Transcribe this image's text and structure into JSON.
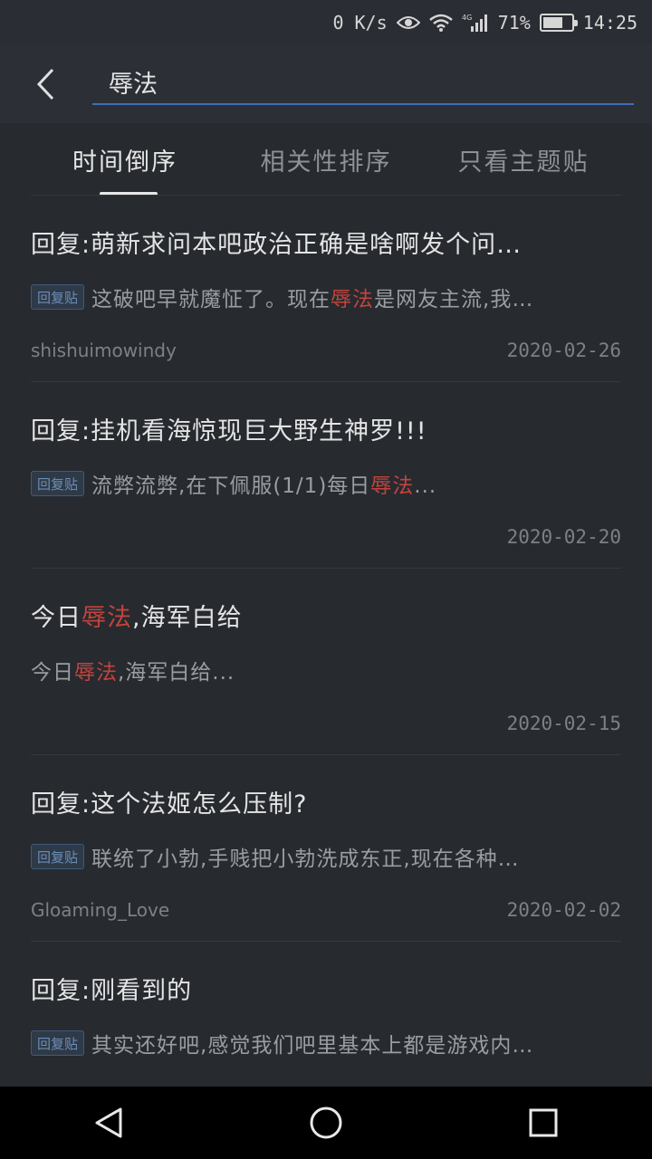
{
  "status_bar": {
    "net_speed": "0 K/s",
    "network": "4G",
    "battery": "71%",
    "battery_level": 0.71,
    "time": "14:25"
  },
  "search": {
    "query": "辱法"
  },
  "tabs": [
    {
      "label": "时间倒序",
      "active": true
    },
    {
      "label": "相关性排序",
      "active": false
    },
    {
      "label": "只看主题贴",
      "active": false
    }
  ],
  "results": [
    {
      "title": "回复:萌新求问本吧政治正确是啥啊发个问…",
      "badge": "回复贴",
      "snippet_before": "这破吧早就魔怔了。现在",
      "snippet_hl": "辱法",
      "snippet_after": "是网友主流,我…",
      "author": "shishuimowindy",
      "date": "2020-02-26"
    },
    {
      "title": "回复:挂机看海惊现巨大野生神罗!!!",
      "badge": "回复贴",
      "snippet_before": "流弊流弊,在下佩服(1/1)每日",
      "snippet_hl": "辱法",
      "snippet_after": "...",
      "author": "",
      "date": "2020-02-20"
    },
    {
      "title_before": "今日",
      "title_hl": "辱法",
      "title_after": ",海军白给",
      "snippet_before": "今日",
      "snippet_hl": "辱法",
      "snippet_after": ",海军白给...",
      "author": "",
      "date": "2020-02-15"
    },
    {
      "title": "回复:这个法姬怎么压制?",
      "badge": "回复贴",
      "snippet_before": "联统了小勃,手贱把小勃洗成东正,现在各种…",
      "snippet_hl": "",
      "snippet_after": "",
      "author": "Gloaming_Love",
      "date": "2020-02-02"
    },
    {
      "title": "回复:刚看到的",
      "badge": "回复贴",
      "snippet_before": "其实还好吧,感觉我们吧里基本上都是游戏内…",
      "snippet_hl": "",
      "snippet_after": "",
      "author": "",
      "date": ""
    }
  ]
}
